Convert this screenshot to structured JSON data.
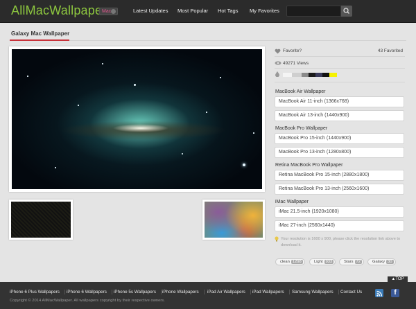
{
  "header": {
    "logo": "AllMacWallpaper",
    "platform_badge": "Mac",
    "nav": [
      "Latest Updates",
      "Most Popular",
      "Hot Tags",
      "My Favorites"
    ],
    "search_placeholder": ""
  },
  "page": {
    "title": "Galaxy Mac Wallpaper"
  },
  "info": {
    "favorite_label": "Favorite?",
    "favorited_count": "43 Favorited",
    "views": "49271 Views",
    "palette": [
      "#f4f4f4",
      "#cfcfcf",
      "#8a8a8a",
      "#1a1a1a",
      "#3a3a5a",
      "#111111",
      "#f6f200"
    ]
  },
  "groups": [
    {
      "label": "MacBook Air Wallpaper",
      "items": [
        "MacBook Air 11-inch (1366x768)",
        "MacBook Air 13-inch (1440x900)"
      ]
    },
    {
      "label": "MacBook Pro Wallpaper",
      "items": [
        "MacBook Pro 15-inch (1440x900)",
        "MacBook Pro 13-inch (1280x800)"
      ]
    },
    {
      "label": "Retina MacBook Pro Wallpaper",
      "items": [
        "Retina MacBook Pro 15-inch (2880x1800)",
        "Retina MacBook Pro 13-inch (2560x1600)"
      ]
    },
    {
      "label": "iMac Wallpaper",
      "items": [
        "iMac 21.5-inch (1920x1080)",
        "iMac 27-inch (2560x1440)"
      ]
    }
  ],
  "hint": "Your resolution is 1600 x 900, please click the resolution link above to download it.",
  "tags": [
    {
      "name": "clean",
      "count": "1298"
    },
    {
      "name": "Light",
      "count": "933"
    },
    {
      "name": "Stars",
      "count": "72"
    },
    {
      "name": "Galaxy",
      "count": "30"
    }
  ],
  "footer": {
    "top_label": "TOP",
    "links": [
      "iPhone 6 Plus Wallpapers",
      "iPhone 6 Wallpapers",
      "iPhone 5s Wallpapers",
      "iPhone Wallpapers",
      "iPad Air Wallpapers",
      "iPad Wallpapers",
      "Samsung Wallpapers",
      "Contact Us"
    ],
    "copyright": "Copyright © 2014 AllMacWallpaper. All wallpapers copyright by their respective owners.",
    "fb_letter": "f"
  }
}
